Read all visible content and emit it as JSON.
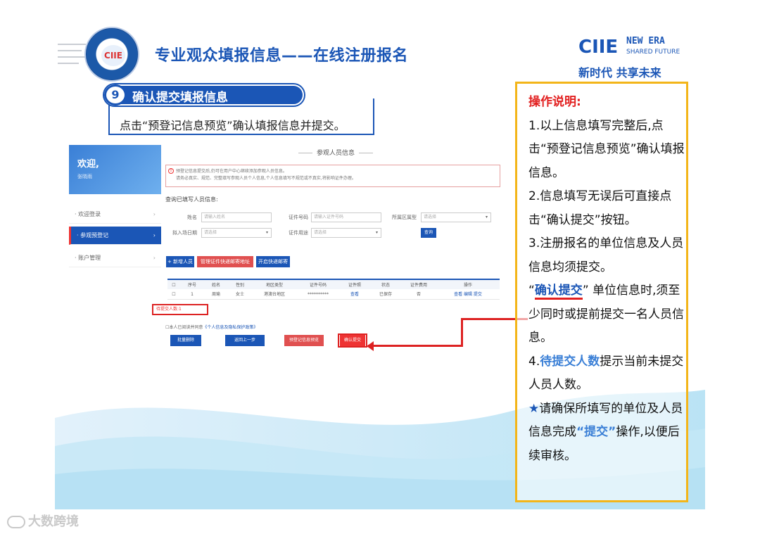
{
  "header": {
    "logo_text": "CIIE",
    "title": "专业观众填报信息——在线注册报名",
    "brand": "CIIE",
    "brand_new": "NEW",
    "brand_era": "ERA",
    "brand_sub": "SHARED FUTURE",
    "slogan": "新时代 共享未来"
  },
  "step": {
    "number": "9",
    "label": "确认提交填报信息",
    "hint": "点击“预登记信息预览”确认填报信息并提交。"
  },
  "screenshot": {
    "sidebar": {
      "welcome": "欢迎,",
      "user": "张晓雨",
      "items": [
        {
          "label": "· 欢迎登录",
          "arrow": "›"
        },
        {
          "label": "· 参观预登记",
          "arrow": "›"
        },
        {
          "label": "· 账户管理",
          "arrow": "›"
        }
      ]
    },
    "section_title": "参观人员信息",
    "notice_icon": "!",
    "notice_line1": "预登记信息提交后,仍可在用户中心继续添加参观人员信息。",
    "notice_line2": "请务必真实、规范、完整填写参观人员个人信息,个人信息填写不规范或不真实,将影响证件办理。",
    "query_label": "查询已填写人员信息:",
    "fields": {
      "name_label": "姓名",
      "name_ph": "请输入姓名",
      "id_label": "证件号码",
      "id_ph": "请输入证件号码",
      "region_label": "所属区属型",
      "region_value": "请选择",
      "date_label": "拟入场日期",
      "date_value": "请选择",
      "use_label": "证件用途",
      "use_value": "请选择",
      "dd": "▾",
      "query_btn": "查询"
    },
    "toolbar": {
      "add": "+ 新增人员",
      "manage": "管理证件快递邮寄地址",
      "batch": "开启快递邮寄"
    },
    "table": {
      "headers": [
        "☐",
        "序号",
        "姓名",
        "性别",
        "地区类型",
        "证件号码",
        "证件照",
        "状态",
        "证件费用",
        "操作"
      ],
      "row": [
        "☐",
        "1",
        "周瑜",
        "女士",
        "港澳台地区",
        "**********",
        "查看",
        "已保存",
        "否",
        "查看 编辑 提交"
      ]
    },
    "pending_count": "待提交人数:1",
    "agree_text": "☐本人已阅读并同意",
    "agree_link": "《个人信息及隐私保护政策》",
    "actions": {
      "batch_delete": "批量删除",
      "back": "返回上一步",
      "preview": "预登记信息预览",
      "confirm": "确认提交"
    }
  },
  "panel": {
    "title": "操作说明:",
    "p1": "1.以上信息填写完整后,点击“预登记信息预览”确认填报信息。",
    "p2": "2.信息填写无误后可直接点击“确认提交”按钮。",
    "p3": "3.注册报名的单位信息及人员信息均须提交。",
    "p3b_pre": "“",
    "p3b_hl": "确认提交",
    "p3b_post": "” 单位信息时,须至少同时或提前提交一名人员信息。",
    "p4_pre": "4.",
    "p4_hl": "待提交人数",
    "p4_post": "提示当前未提交人员人数。",
    "star": "★",
    "p5_pre": "请确保所填写的单位及人员信息完成",
    "p5_hl": "“提交”",
    "p5_post": "操作,以便后续审核。"
  },
  "watermark": "大数跨境",
  "colors": {
    "brand_blue": "#1b56b6",
    "accent_red": "#e21f1f",
    "panel_border": "#f3b519"
  }
}
